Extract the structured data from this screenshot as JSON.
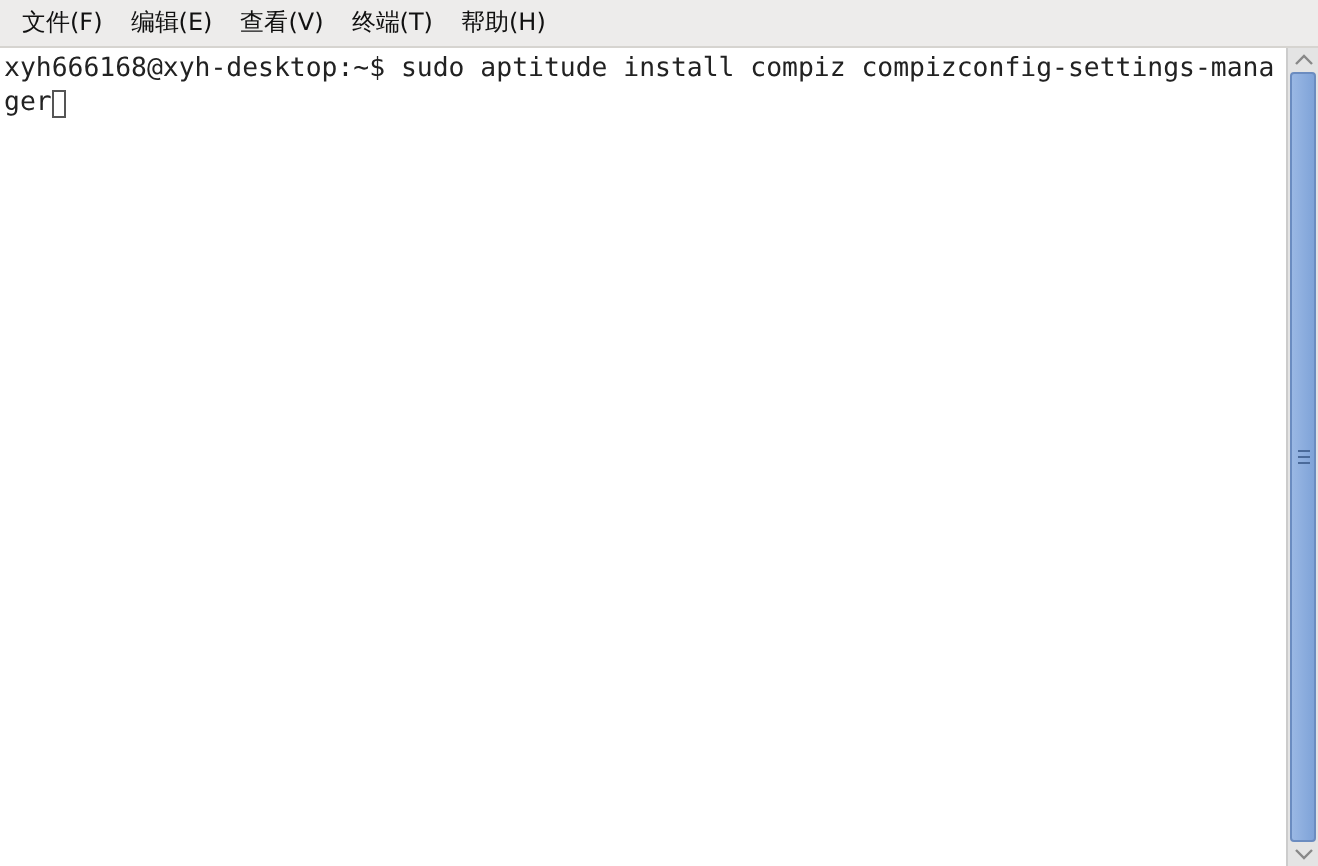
{
  "menu_bar": [
    {
      "label": "文件(F)"
    },
    {
      "label": "编辑(E)"
    },
    {
      "label": "查看(V)"
    },
    {
      "label": "终端(T)"
    },
    {
      "label": "帮助(H)"
    }
  ],
  "terminal": {
    "lines": [
      "xyh666168@xyh-desktop:~$ sudo aptitude install compiz compizconfig-settings-mana",
      "ger"
    ]
  }
}
